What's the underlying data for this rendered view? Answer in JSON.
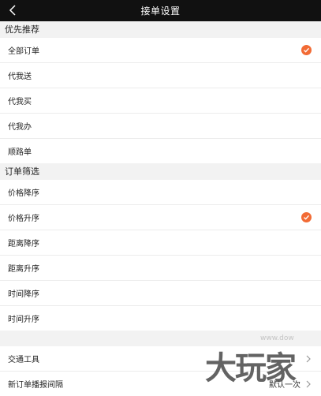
{
  "header": {
    "title": "接单设置"
  },
  "sections": [
    {
      "label": "优先推荐",
      "items": [
        {
          "label": "全部订单",
          "checked": true
        },
        {
          "label": "代我送",
          "checked": false
        },
        {
          "label": "代我买",
          "checked": false
        },
        {
          "label": "代我办",
          "checked": false
        },
        {
          "label": "顺路单",
          "checked": false
        }
      ]
    },
    {
      "label": "订单筛选",
      "items": [
        {
          "label": "价格降序",
          "checked": false
        },
        {
          "label": "价格升序",
          "checked": true
        },
        {
          "label": "距离降序",
          "checked": false
        },
        {
          "label": "距离升序",
          "checked": false
        },
        {
          "label": "时间降序",
          "checked": false
        },
        {
          "label": "时间升序",
          "checked": false
        }
      ]
    }
  ],
  "settings": [
    {
      "label": "交通工具",
      "value": ""
    },
    {
      "label": "新订单播报间隔",
      "value": "默认一次"
    }
  ],
  "watermark": {
    "text": "大玩家",
    "url": "www.dow"
  },
  "colors": {
    "accent": "#f26b35",
    "header_bg": "#111111"
  },
  "icons": {
    "back": "chevron-left-icon",
    "check": "check-circle-icon",
    "chevron": "chevron-right-icon"
  }
}
